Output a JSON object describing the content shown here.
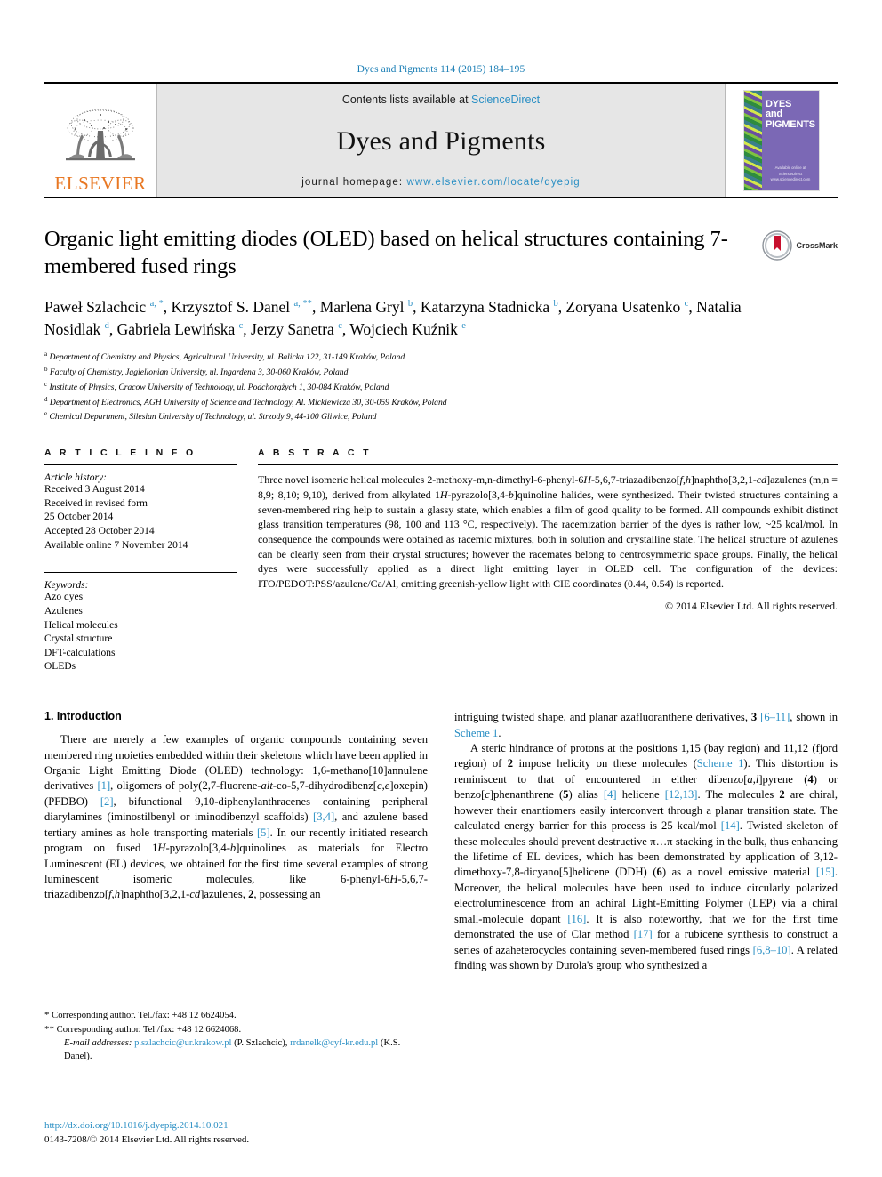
{
  "running_head": "Dyes and Pigments 114 (2015) 184–195",
  "masthead": {
    "publisher_logo_text": "ELSEVIER",
    "contents_prefix": "Contents lists available at ",
    "contents_link": "ScienceDirect",
    "journal_name": "Dyes and Pigments",
    "homepage_prefix": "journal homepage: ",
    "homepage_url": "www.elsevier.com/locate/dyepig",
    "cover": {
      "line1": "DYES",
      "line2": "and",
      "line3": "PIGMENTS",
      "footer1": "Available online at",
      "footer2": "ScienceDirect",
      "footer3": "www.sciencedirect.com"
    }
  },
  "title": "Organic light emitting diodes (OLED) based on helical structures containing 7-membered fused rings",
  "crossmark_label": "CrossMark",
  "authors_html": "Paweł Szlachcic <sup>a, *</sup>, Krzysztof S. Danel <sup>a, **</sup>, Marlena Gryl <sup>b</sup>, Katarzyna Stadnicka <sup>b</sup>, Zoryana Usatenko <sup>c</sup>, Natalia Nosidlak <sup>d</sup>, Gabriela Lewińska <sup>c</sup>, Jerzy Sanetra <sup>c</sup>, Wojciech Kuźnik <sup>e</sup>",
  "affiliations": [
    {
      "mark": "a",
      "text": "Department of Chemistry and Physics, Agricultural University, ul. Balicka 122, 31-149 Kraków, Poland"
    },
    {
      "mark": "b",
      "text": "Faculty of Chemistry, Jagiellonian University, ul. Ingardena 3, 30-060 Kraków, Poland"
    },
    {
      "mark": "c",
      "text": "Institute of Physics, Cracow University of Technology, ul. Podchorążych 1, 30-084 Kraków, Poland"
    },
    {
      "mark": "d",
      "text": "Department of Electronics, AGH University of Science and Technology, Al. Mickiewicza 30, 30-059 Kraków, Poland"
    },
    {
      "mark": "e",
      "text": "Chemical Department, Silesian University of Technology, ul. Strzody 9, 44-100 Gliwice, Poland"
    }
  ],
  "article_info": {
    "heading": "A R T I C L E   I N F O",
    "history_label": "Article history:",
    "history": [
      "Received 3 August 2014",
      "Received in revised form",
      "25 October 2014",
      "Accepted 28 October 2014",
      "Available online 7 November 2014"
    ],
    "keywords_label": "Keywords:",
    "keywords": [
      "Azo dyes",
      "Azulenes",
      "Helical molecules",
      "Crystal structure",
      "DFT-calculations",
      "OLEDs"
    ]
  },
  "abstract": {
    "heading": "A B S T R A C T",
    "html": "Three novel isomeric helical molecules 2-methoxy-m,n-dimethyl-6-phenyl-6<i>H</i>-5,6,7-triazadibenzo[<i>f</i>,<i>h</i>]naphtho[3,2,1-<i>cd</i>]azulenes (m,n = 8,9; 8,10; 9,10), derived from alkylated 1<i>H</i>-pyrazolo[3,4-<i>b</i>]quinoline halides, were synthesized. Their twisted structures containing a seven-membered ring help to sustain a glassy state, which enables a film of good quality to be formed. All compounds exhibit distinct glass transition temperatures (98, 100 and 113 °C, respectively). The racemization barrier of the dyes is rather low, ~25 kcal/mol. In consequence the compounds were obtained as racemic mixtures, both in solution and crystalline state. The helical structure of azulenes can be clearly seen from their crystal structures; however the racemates belong to centrosymmetric space groups. Finally, the helical dyes were successfully applied as a direct light emitting layer in OLED cell. The configuration of the devices: ITO/PEDOT:PSS/azulene/Ca/Al, emitting greenish-yellow light with CIE coordinates (0.44, 0.54) is reported.",
    "copyright": "© 2014 Elsevier Ltd. All rights reserved."
  },
  "body": {
    "section_number_title": "1. Introduction",
    "left_paragraph_html": "There are merely a few examples of organic compounds containing seven membered ring moieties embedded within their skeletons which have been applied in Organic Light Emitting Diode (OLED) technology: 1,6-methano[10]annulene derivatives <span class=\"ref\">[1]</span>, oligomers of poly(2,7-fluorene-<i>alt</i>-co-5,7-dihydrodibenz[<i>c</i>,<i>e</i>]oxepin)(PFDBO) <span class=\"ref\">[2]</span>, bifunctional 9,10-diphenylanthracenes containing peripheral diarylamines (iminostilbenyl or iminodibenzyl scaffolds) <span class=\"ref\">[3,4]</span>, and azulene based tertiary amines as hole transporting materials <span class=\"ref\">[5]</span>. In our recently initiated research program on fused 1<i>H</i>-pyrazolo[3,4-<i>b</i>]quinolines as materials for Electro Luminescent (EL) devices, we obtained for the first time several examples of strong luminescent isomeric molecules, like 6-phenyl-6<i>H</i>-5,6,7-triazadibenzo[<i>f</i>,<i>h</i>]naphtho[3,2,1-<i>cd</i>]azulenes, <b>2</b>, possessing an",
    "right_paragraph_1_html": "intriguing twisted shape, and planar azafluoranthene derivatives, <b>3</b> <span class=\"ref\">[6–11]</span>, shown in <span class=\"ref\">Scheme 1</span>.",
    "right_paragraph_2_html": "A steric hindrance of protons at the positions 1,15 (bay region) and 11,12 (fjord region) of <b>2</b> impose helicity on these molecules (<span class=\"ref\">Scheme 1</span>). This distortion is reminiscent to that of encountered in either dibenzo[<i>a</i>,<i>l</i>]pyrene (<b>4</b>) or benzo[<i>c</i>]phenanthrene (<b>5</b>) alias <span class=\"ref\">[4]</span> helicene <span class=\"ref\">[12,13]</span>. The molecules <b>2</b> are chiral, however their enantiomers easily interconvert through a planar transition state. The calculated energy barrier for this process is 25 kcal/mol <span class=\"ref\">[14]</span>. Twisted skeleton of these molecules should prevent destructive π…π stacking in the bulk, thus enhancing the lifetime of EL devices, which has been demonstrated by application of 3,12-dimethoxy-7,8-dicyano[5]helicene (DDH) (<b>6</b>) as a novel emissive material <span class=\"ref\">[15]</span>. Moreover, the helical molecules have been used to induce circularly polarized electroluminescence from an achiral Light-Emitting Polymer (LEP) via a chiral small-molecule dopant <span class=\"ref\">[16]</span>. It is also noteworthy, that we for the first time demonstrated the use of Clar method <span class=\"ref\">[17]</span> for a rubicene synthesis to construct a series of azaheterocycles containing seven-membered fused rings <span class=\"ref\">[6,8–10]</span>. A related finding was shown by Durola's group who synthesized a"
  },
  "footnotes": {
    "line1": "Corresponding author. Tel./fax: +48 12 6624054.",
    "line2": "Corresponding author. Tel./fax: +48 12 6624068.",
    "email_label": "E-mail addresses:",
    "email1": "p.szlachcic@ur.krakow.pl",
    "email1_owner": "(P. Szlachcic),",
    "email2": "rrdanelk@cyf-kr.edu.pl",
    "email2_owner": "(K.S. Danel)."
  },
  "doi_block": {
    "doi_url": "http://dx.doi.org/10.1016/j.dyepig.2014.10.021",
    "issn_line": "0143-7208/© 2014 Elsevier Ltd. All rights reserved."
  },
  "colors": {
    "link": "#2a8fc4",
    "elsevier_orange": "#E87722",
    "cover_purple": "#7b68b5"
  }
}
